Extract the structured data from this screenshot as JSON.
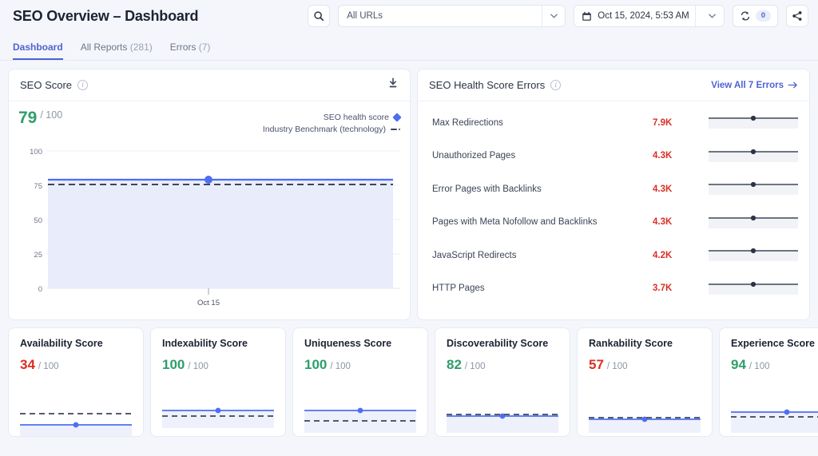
{
  "header": {
    "title": "SEO Overview – Dashboard",
    "search_icon": "search-icon",
    "url_filter": {
      "value": "All URLs",
      "caret": "chevron-down-icon"
    },
    "date_filter": {
      "calendar_icon": "calendar-icon",
      "value": "Oct 15, 2024, 5:53 AM",
      "caret": "chevron-down-icon"
    },
    "refresh": {
      "icon": "refresh-icon",
      "badge": "0"
    },
    "share_icon": "share-icon"
  },
  "tabs": [
    {
      "label": "Dashboard",
      "count": "",
      "active": true
    },
    {
      "label": "All Reports",
      "count": "(281)",
      "active": false
    },
    {
      "label": "Errors",
      "count": "(7)",
      "active": false
    }
  ],
  "seo_score_card": {
    "title": "SEO Score",
    "info_icon": "info-icon",
    "download_icon": "download-icon",
    "score": "79",
    "denominator": "/ 100",
    "legend": [
      {
        "label": "SEO health score",
        "marker": "diamond",
        "color": "#4e6ef2"
      },
      {
        "label": "Industry Benchmark (technology)",
        "marker": "dashed-line",
        "color": "#3d4657"
      }
    ]
  },
  "errors_card": {
    "title": "SEO Health Score Errors",
    "info_icon": "info-icon",
    "view_all_label": "View All 7 Errors",
    "arrow_icon": "arrow-right-icon",
    "rows": [
      {
        "label": "Max Redirections",
        "value": "7.9K"
      },
      {
        "label": "Unauthorized Pages",
        "value": "4.3K"
      },
      {
        "label": "Error Pages with Backlinks",
        "value": "4.3K"
      },
      {
        "label": "Pages with Meta Nofollow and Backlinks",
        "value": "4.3K"
      },
      {
        "label": "JavaScript Redirects",
        "value": "4.2K"
      },
      {
        "label": "HTTP Pages",
        "value": "3.7K"
      }
    ]
  },
  "score_cards": [
    {
      "title": "Availability Score",
      "score": "34",
      "denominator": "/ 100",
      "tone": "bad",
      "line_pct": 34,
      "benchmark_pct": 62
    },
    {
      "title": "Indexability Score",
      "score": "100",
      "denominator": "/ 100",
      "tone": "good",
      "line_pct": 100,
      "benchmark_pct": 80
    },
    {
      "title": "Uniqueness Score",
      "score": "100",
      "denominator": "/ 100",
      "tone": "good",
      "line_pct": 100,
      "benchmark_pct": 62
    },
    {
      "title": "Discoverability Score",
      "score": "82",
      "denominator": "/ 100",
      "tone": "good",
      "line_pct": 82,
      "benchmark_pct": 84
    },
    {
      "title": "Rankability Score",
      "score": "57",
      "denominator": "/ 100",
      "tone": "bad",
      "line_pct": 57,
      "benchmark_pct": 60
    },
    {
      "title": "Experience Score",
      "score": "94",
      "denominator": "/ 100",
      "tone": "good",
      "line_pct": 94,
      "benchmark_pct": 80
    }
  ],
  "chart_data": {
    "type": "line",
    "title": "SEO Score",
    "xlabel": "",
    "ylabel": "",
    "x": [
      "Oct 15"
    ],
    "ylim": [
      0,
      100
    ],
    "yticks": [
      0,
      25,
      50,
      75,
      100
    ],
    "grid": true,
    "legend_position": "top-right",
    "series": [
      {
        "name": "SEO health score",
        "values": [
          79
        ],
        "color": "#4e6ef2",
        "style": "solid-area",
        "marker": "circle"
      },
      {
        "name": "Industry Benchmark (technology)",
        "values": [
          76
        ],
        "color": "#3d4657",
        "style": "dashed"
      }
    ]
  },
  "error_sparklines": {
    "type": "line",
    "note": "mini constant-value sparkline per error row",
    "series": [
      {
        "name": "Max Redirections",
        "dot_x_pct": 50,
        "line_color": "#3d4657"
      },
      {
        "name": "Unauthorized Pages",
        "dot_x_pct": 50,
        "line_color": "#3d4657"
      },
      {
        "name": "Error Pages with Backlinks",
        "dot_x_pct": 50,
        "line_color": "#3d4657"
      },
      {
        "name": "Pages with Meta Nofollow and Backlinks",
        "dot_x_pct": 50,
        "line_color": "#3d4657"
      },
      {
        "name": "JavaScript Redirects",
        "dot_x_pct": 50,
        "line_color": "#3d4657"
      },
      {
        "name": "HTTP Pages",
        "dot_x_pct": 50,
        "line_color": "#3d4657"
      }
    ]
  }
}
